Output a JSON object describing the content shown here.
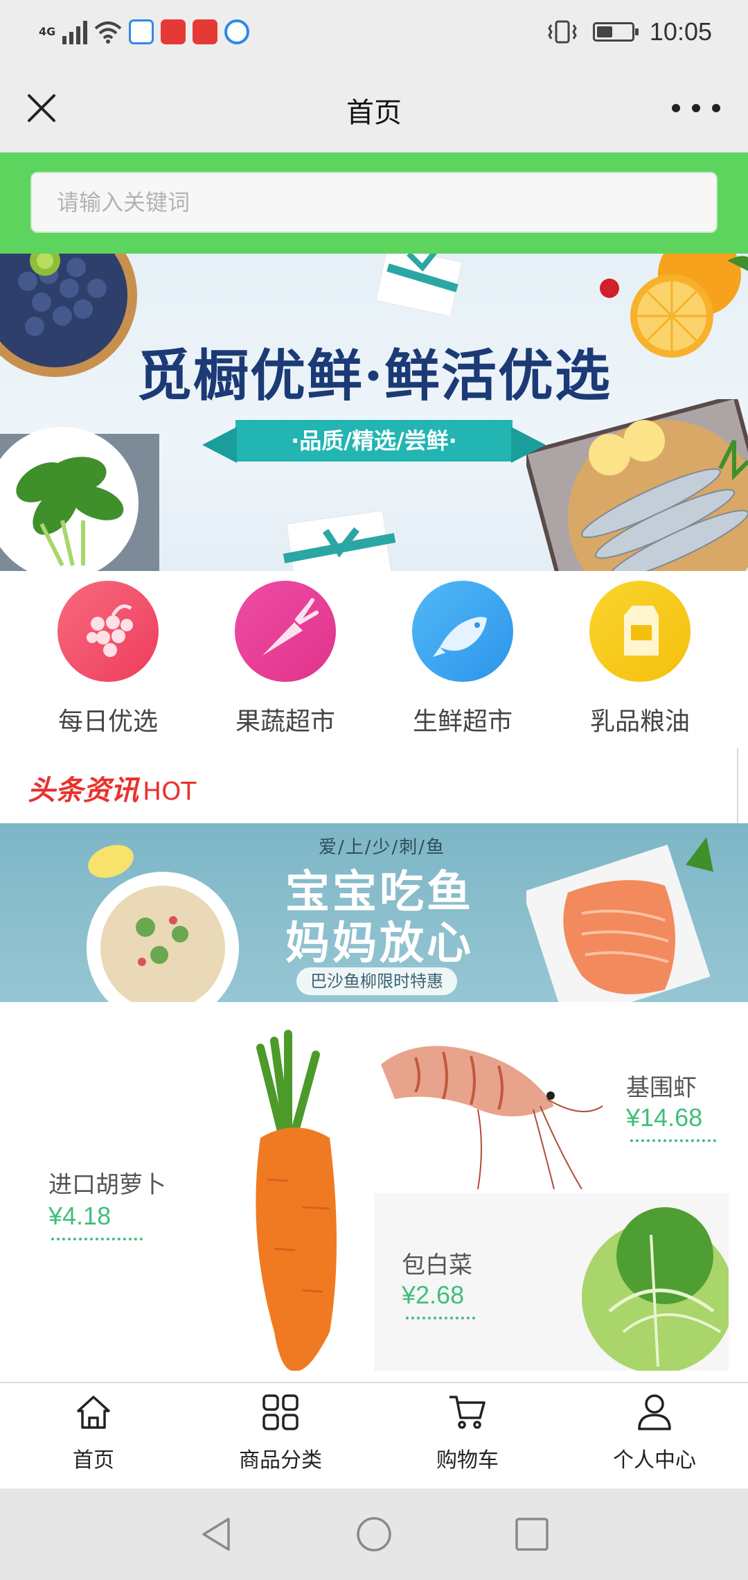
{
  "status_bar": {
    "network": "4G",
    "time": "10:05",
    "battery_level": 0.45
  },
  "nav": {
    "title": "首页"
  },
  "search": {
    "placeholder": "请输入关键词"
  },
  "hero": {
    "title": "觅橱优鲜·鲜活优选",
    "ribbon": "·品质/精选/尝鲜·"
  },
  "categories": [
    {
      "label": "每日优选",
      "icon": "grapes-icon",
      "color": "#f04e6e"
    },
    {
      "label": "果蔬超市",
      "icon": "carrot-icon",
      "color": "#e8409a"
    },
    {
      "label": "生鲜超市",
      "icon": "fish-icon",
      "color": "#3ea8f2"
    },
    {
      "label": "乳品粮油",
      "icon": "milk-carton-icon",
      "color": "#f7c81a"
    }
  ],
  "headline": {
    "title": "头条资讯",
    "hot": "HOT"
  },
  "fish_banner": {
    "subtitle": "爱/上/少/刺/鱼",
    "line1": "宝宝吃鱼",
    "line2": "妈妈放心",
    "tag": "巴沙鱼柳限时特惠"
  },
  "products": [
    {
      "name": "进口胡萝卜",
      "price": "¥4.18"
    },
    {
      "name": "基围虾",
      "price": "¥14.68"
    },
    {
      "name": "包白菜",
      "price": "¥2.68"
    }
  ],
  "tabbar": [
    {
      "label": "首页",
      "icon": "home-icon"
    },
    {
      "label": "商品分类",
      "icon": "grid-icon"
    },
    {
      "label": "购物车",
      "icon": "cart-icon"
    },
    {
      "label": "个人中心",
      "icon": "user-icon"
    }
  ],
  "colors": {
    "brand_green": "#5dd45d",
    "price_green": "#3fbf7a",
    "hot_red": "#e8322e"
  }
}
